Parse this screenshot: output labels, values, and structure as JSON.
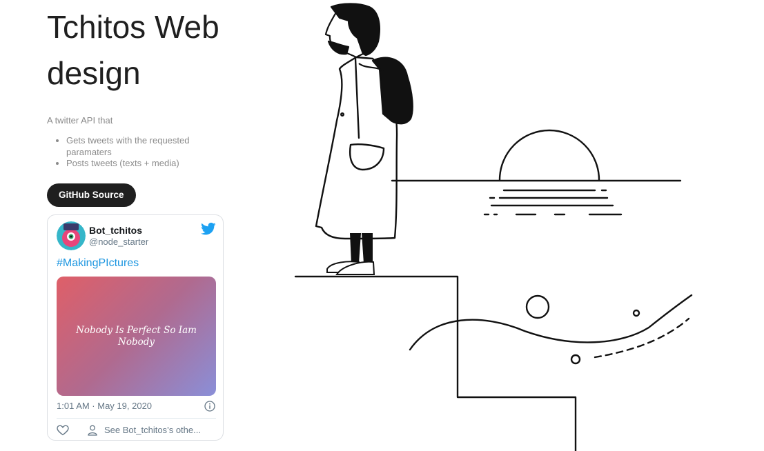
{
  "hero": {
    "title": "Tchitos Web design",
    "intro": "A twitter API that",
    "features": [
      "Gets tweets with the requested paramaters",
      "Posts tweets (texts + media)"
    ],
    "github_button_label": "GitHub Source"
  },
  "tweet": {
    "display_name": "Bot_tchitos",
    "handle": "@node_starter",
    "hashtag": "#MakingPIctures",
    "media_caption": "Nobody Is Perfect So Iam Nobody",
    "timestamp": "1:01 AM · May 19, 2020",
    "profile_link": "See Bot_tchitos’s othe...",
    "colors": {
      "link": "#1b95e0",
      "muted": "#657786",
      "twitter_blue": "#1da1f2"
    },
    "icons": [
      "twitter-bird-icon",
      "info-icon",
      "heart-icon",
      "person-icon"
    ]
  },
  "colors": {
    "button_bg": "#1f1f1f",
    "text_muted": "#8a8a8a",
    "title": "#1f1f1f"
  }
}
